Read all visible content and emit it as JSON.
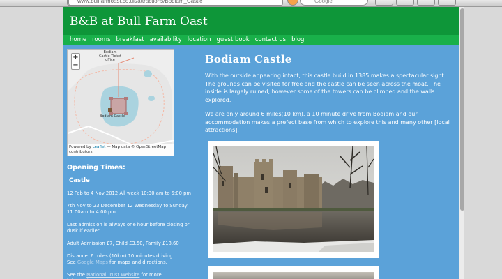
{
  "browser": {
    "url": "www.bullfarmoast.co.uk/attractions/Bodiam_Castle",
    "search_placeholder": "Google"
  },
  "site": {
    "title": "B&B at Bull Farm Oast"
  },
  "nav": {
    "items": [
      "home",
      "rooms",
      "breakfast",
      "availability",
      "location",
      "guest book",
      "contact us",
      "blog"
    ]
  },
  "map": {
    "zoom_in": "+",
    "zoom_out": "−",
    "label_top": "Bodiam Castle Ticket office",
    "label_castle": "Bodiam Castle",
    "attribution_prefix": "Powered by",
    "attribution_link": "Leaflet",
    "attribution_rest": "— Map data © OpenStreetMap contributors"
  },
  "sidebar": {
    "heading": "Opening Times:",
    "subheading": "Castle",
    "line1": "12 Feb to 4 Nov 2012 All week 10:30 am to 5:00 pm",
    "line2": "7th Nov to 23 December 12 Wednesday to Sunday 11:00am to 4:00 pm",
    "line3": "Last admission is always one hour before closing or dusk if earlier.",
    "line4": "Adult Admission £7, Child £3.50, Family £18.60",
    "line5": "Distance: 6 miles (10km) 10 minutes driving.",
    "line6_pre": "See",
    "line6_link": "Google Maps",
    "line6_post": "for maps and directions.",
    "line7_pre": "See the",
    "line7_link": "National Trust Website",
    "line7_post": "for more information*"
  },
  "main": {
    "title": "Bodiam Castle",
    "para1": "With the outside appearing intact, this castle build in 1385 makes a spectacular sight. The grounds can be visited for free and the castle can be seen across the moat. The inside is largely ruined, however some of the towers can be climbed and the walls explored.",
    "para2": "We are only around 6 miles(10 km), a 10 minute drive from Bodiam and our accommodation makes a prefect base from which to explore this and many other [local attractions]."
  },
  "colors": {
    "page_bg": "#5ba2d9",
    "header_green": "#0e9639",
    "nav_green": "#19b04a"
  }
}
